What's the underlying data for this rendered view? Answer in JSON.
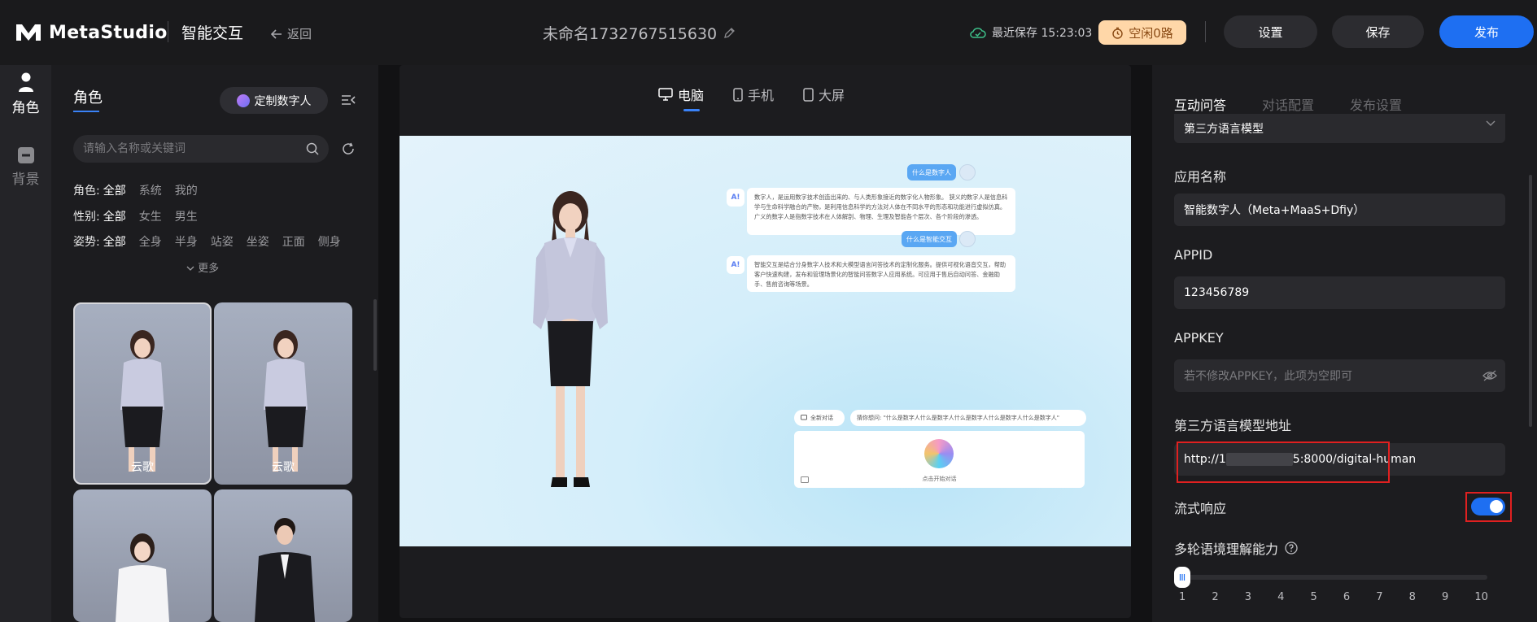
{
  "header": {
    "brand": "MetaStudio",
    "module": "智能交互",
    "back_label": "返回",
    "doc_title": "未命名1732767515630",
    "save_status": "最近保存 15:23:03",
    "idle_badge": "空闲0路",
    "settings_label": "设置",
    "save_label": "保存",
    "publish_label": "发布"
  },
  "sidenav": {
    "items": [
      {
        "label": "角色",
        "icon": "person-icon",
        "active": true
      },
      {
        "label": "背景",
        "icon": "background-icon",
        "active": false
      }
    ]
  },
  "left": {
    "tab": "角色",
    "custom_button": "定制数字人",
    "search_placeholder": "请输入名称或关键词",
    "filters": [
      {
        "label": "角色:",
        "options": [
          "全部",
          "系统",
          "我的"
        ],
        "selected": 0
      },
      {
        "label": "性别:",
        "options": [
          "全部",
          "女生",
          "男生"
        ],
        "selected": 0
      },
      {
        "label": "姿势:",
        "options": [
          "全部",
          "全身",
          "半身",
          "站姿",
          "坐姿",
          "正面",
          "侧身"
        ],
        "selected": 0
      }
    ],
    "more_label": "更多",
    "cards": [
      {
        "name": "云歌",
        "selected": true
      },
      {
        "name": "云歌",
        "selected": false
      },
      {
        "name": "",
        "selected": false
      },
      {
        "name": "",
        "selected": false
      }
    ]
  },
  "preview": {
    "device_tabs": [
      "电脑",
      "手机",
      "大屏"
    ],
    "active_device": 0,
    "chat": {
      "q1": "什么是数字人",
      "a1": "数字人，是运用数字技术创造出来的、与人类形象接近的数字化人物形象。 狭义的数字人是信息科学与生命科学融合的产物，是利用信息科学的方法对人体在不同水平的形态和功能进行虚拟仿真。广义的数字人是指数字技术在人体解剖、物理、生理及智能各个层次、各个阶段的渗透。",
      "q2": "什么是智能交互",
      "a2": "智能交互是结合分身数字人技术和大模型语言问答技术的定制化服务。提供可视化语音交互，帮助客户快速构建，发布和管理场景化的智能问答数字人应用系统。可应用于售后自动问答、金融助手、售前咨询等场景。",
      "ai_badge": "A!",
      "new_chat": "全新对话",
      "suggest": "猜你想问: \"什么是数字人什么是数字人什么是数字人什么是数字人什么是数字人\"",
      "start_hint": "点击开始对话"
    }
  },
  "right": {
    "tabs": [
      "互动问答",
      "对话配置",
      "发布设置"
    ],
    "active_tab": 0,
    "model_value": "第三方语言模型",
    "app_name_label": "应用名称",
    "app_name_value": "智能数字人（Meta+MaaS+Dfiy）",
    "appid_label": "APPID",
    "appid_value": "123456789",
    "appkey_label": "APPKEY",
    "appkey_placeholder": "若不修改APPKEY，此项为空即可",
    "url_label": "第三方语言模型地址",
    "url_prefix": "http://1",
    "url_suffix": "5:8000/digital-human",
    "stream_label": "流式响应",
    "stream_on": true,
    "multiturn_label": "多轮语境理解能力",
    "slider_ticks": [
      "1",
      "2",
      "3",
      "4",
      "5",
      "6",
      "7",
      "8",
      "9",
      "10"
    ],
    "slider_value": 1
  },
  "colors": {
    "accent": "#1e6ff2",
    "highlight_box": "#e02020",
    "idle_badge_bg": "#ffd7a8"
  }
}
